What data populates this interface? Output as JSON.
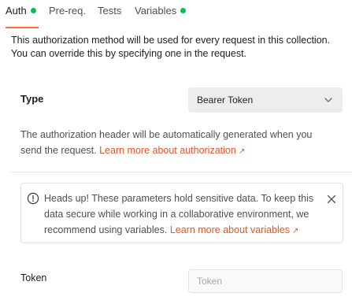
{
  "tabs": [
    {
      "label": "Auth",
      "active": true,
      "dot": true
    },
    {
      "label": "Pre-req.",
      "active": false,
      "dot": false
    },
    {
      "label": "Tests",
      "active": false,
      "dot": false
    },
    {
      "label": "Variables",
      "active": false,
      "dot": true
    }
  ],
  "colors": {
    "accent": "#ff6c37",
    "dot": "#0cbb52",
    "link": "#e0562a"
  },
  "description": "This authorization method will be used for every request in this collection. You can override this by specifying one in the request.",
  "type": {
    "label": "Type",
    "selected": "Bearer Token",
    "icon": "chevron-down-icon"
  },
  "help": {
    "text": "The authorization header will be automatically generated when you send the request.",
    "link": "Learn more about authorization",
    "link_icon": "↗"
  },
  "alert": {
    "icon": "info-circle-icon",
    "text": "Heads up! These parameters hold sensitive data. To keep this data secure while working in a collaborative environment, we recommend using variables.",
    "link": "Learn more about variables",
    "link_icon": "↗",
    "close_icon": "close-icon"
  },
  "token": {
    "label": "Token",
    "value": "",
    "placeholder": "Token"
  }
}
